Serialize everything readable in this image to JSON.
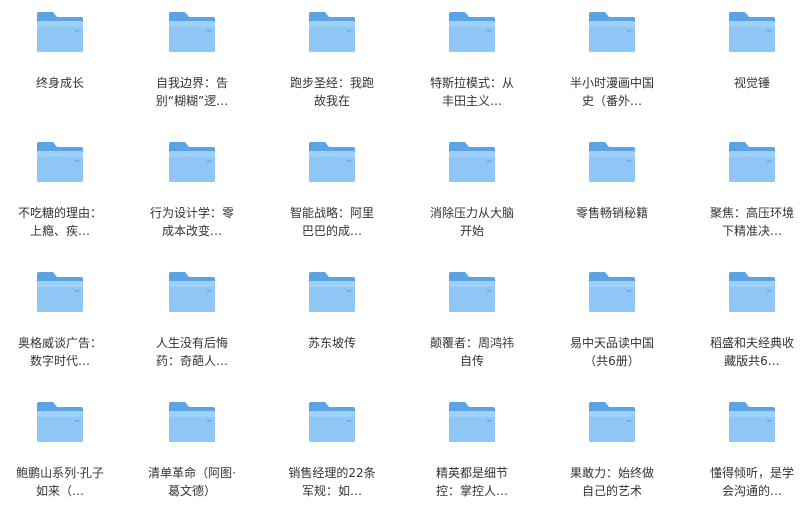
{
  "folder_icon_colors": {
    "back": "#5aa4e6",
    "front": "#8ec6f6",
    "front_light": "#9fd0f8"
  },
  "folders": [
    {
      "label": "终身成长",
      "icon": "folder-icon"
    },
    {
      "label": "自我边界：告别“糊糊”逻…",
      "icon": "folder-icon"
    },
    {
      "label": "跑步圣经：我跑故我在",
      "icon": "folder-icon"
    },
    {
      "label": "特斯拉模式：从丰田主义…",
      "icon": "folder-icon"
    },
    {
      "label": "半小时漫画中国史（番外…",
      "icon": "folder-icon"
    },
    {
      "label": "视觉锤",
      "icon": "folder-icon"
    },
    {
      "label": "不吃糖的理由：上瘾、疾…",
      "icon": "folder-icon"
    },
    {
      "label": "行为设计学：零成本改变…",
      "icon": "folder-icon"
    },
    {
      "label": "智能战略：阿里巴巴的成…",
      "icon": "folder-icon"
    },
    {
      "label": "消除压力从大脑开始",
      "icon": "folder-icon"
    },
    {
      "label": "零售畅销秘籍",
      "icon": "folder-icon"
    },
    {
      "label": "聚焦：高压环境下精准决…",
      "icon": "folder-icon"
    },
    {
      "label": "奥格威谈广告：数字时代…",
      "icon": "folder-icon"
    },
    {
      "label": "人生没有后悔药：奇葩人…",
      "icon": "folder-icon"
    },
    {
      "label": "苏东坡传",
      "icon": "folder-icon"
    },
    {
      "label": "颠覆者：周鸿祎自传",
      "icon": "folder-icon"
    },
    {
      "label": "易中天品读中国（共6册）",
      "icon": "folder-icon"
    },
    {
      "label": "稻盛和夫经典收藏版共6…",
      "icon": "folder-icon"
    },
    {
      "label": "鲍鹏山系列·孔子如来（…",
      "icon": "folder-icon"
    },
    {
      "label": "清单革命（阿图·葛文德）",
      "icon": "folder-icon"
    },
    {
      "label": "销售经理的22条军规：如…",
      "icon": "folder-icon"
    },
    {
      "label": "精英都是细节控：掌控人…",
      "icon": "folder-icon"
    },
    {
      "label": "果敢力：始终做自己的艺术",
      "icon": "folder-icon"
    },
    {
      "label": "懂得倾听，是学会沟通的…",
      "icon": "folder-icon"
    }
  ]
}
